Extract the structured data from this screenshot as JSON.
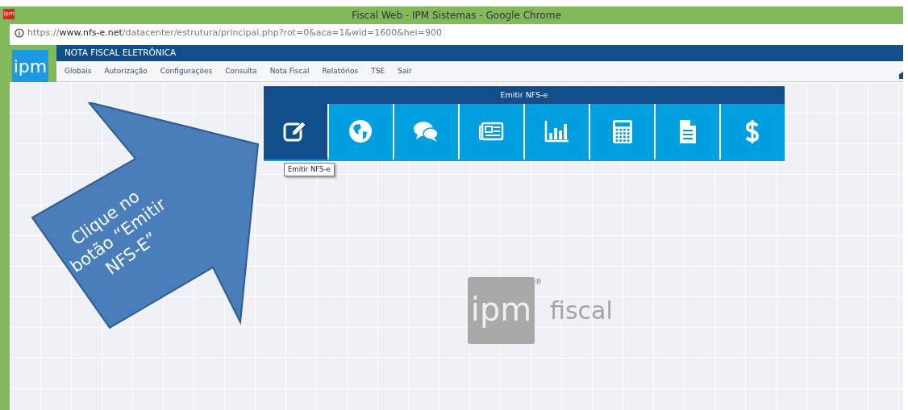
{
  "window": {
    "favicon": "ipm",
    "title": "Fiscal Web - IPM Sistemas - Google Chrome"
  },
  "address_bar": {
    "scheme": "https://",
    "host": "www.nfs-e.net",
    "path": "/datacenter/estrutura/principal.php?rot=0&aca=1&wid=1600&hei=900"
  },
  "header": {
    "logo": "ipm",
    "title": "NOTA FISCAL ELETRÔNICA"
  },
  "menu": [
    "Globais",
    "Autorização",
    "Configurações",
    "Consulta",
    "Nota Fiscal",
    "Relatórios",
    "TSE",
    "Sair"
  ],
  "panel": {
    "title": "Emitir NFS-e",
    "tiles": [
      {
        "kind": "edit",
        "selected": true
      },
      {
        "kind": "globe",
        "selected": false
      },
      {
        "kind": "chat",
        "selected": false
      },
      {
        "kind": "news",
        "selected": false
      },
      {
        "kind": "chart",
        "selected": false
      },
      {
        "kind": "calculator",
        "selected": false
      },
      {
        "kind": "document",
        "selected": false
      },
      {
        "kind": "dollar",
        "selected": false
      }
    ]
  },
  "tooltip": "Emitir NFS-e",
  "callout": "Clique no botão “Emitir NFS-E”",
  "brand": {
    "logo": "ipm",
    "name": "fiscal",
    "mark": "®"
  }
}
